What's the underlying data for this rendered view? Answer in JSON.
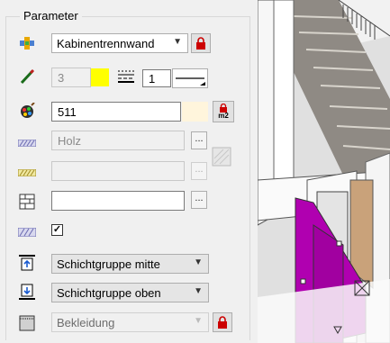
{
  "parameter": {
    "group_title": "Parameter",
    "component_type": "Kabinentrennwand",
    "pen_value": "3",
    "line_style_value": "1",
    "fill_color": "#ffff00",
    "material_number": "511",
    "material_color": "#fff5dc",
    "surface_material": "Holz",
    "pattern_text": "",
    "hatch_text": "",
    "checkbox_checked": true,
    "layer_top_ref": "Schichtgruppe mitte",
    "layer_bottom_ref": "Schichtgruppe oben",
    "attribute": "Bekleidung",
    "lock_label": "m2",
    "more_label": "...",
    "check_mark": "✓"
  },
  "colors": {
    "accent_lock": "#cc0000",
    "magenta_door": "#b000b0"
  },
  "icons": [
    "component-icon",
    "pen-icon",
    "linestyle-icon",
    "color-palette-icon",
    "surface-icon",
    "pattern-icon",
    "hatch-icon",
    "brick-icon",
    "layer-icon",
    "top-ref-icon",
    "bottom-ref-icon",
    "attribute-icon",
    "lock-icon"
  ]
}
